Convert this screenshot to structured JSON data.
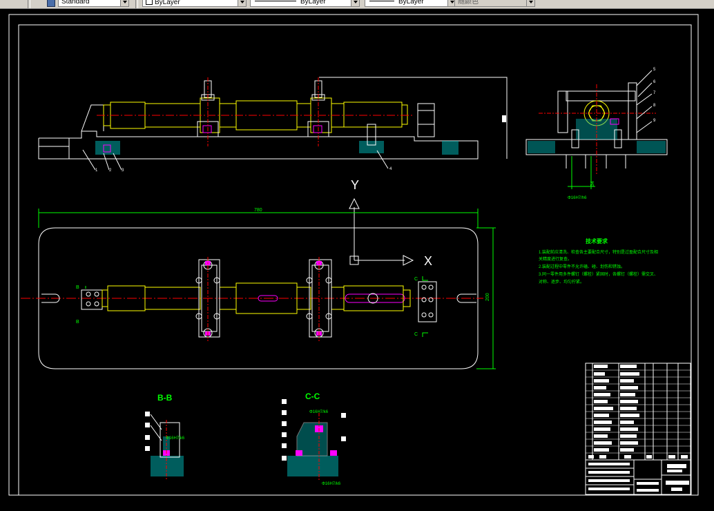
{
  "toolbar": {
    "text_style": "Standard",
    "layer": "ByLayer",
    "linetype": "ByLayer",
    "lineweight": "ByLayer",
    "plot_style": "随颜色"
  },
  "drawing": {
    "section_bb": "B-B",
    "section_cc": "C-C",
    "dim_length": "780",
    "dim_width": "200",
    "dim_fit_top": "Φ16H7/h6",
    "dim_fit_bb": "Φ16H7/k6",
    "dim_fit_cc": "Φ16H7/k6",
    "dim_fit_cc2": "Φ16H7/k6",
    "dim_small": "34",
    "ucs_y": "Y",
    "ucs_x": "X",
    "mark_b": "B",
    "mark_c": "C",
    "part_numbers": [
      "1",
      "2",
      "3",
      "4",
      "5",
      "6",
      "7",
      "8",
      "9"
    ]
  },
  "tech_req": {
    "title": "技术要求",
    "lines": [
      "1.装配前应清洗、检查各主要配合尺寸，特别是过盈配合尺寸及相",
      "关精度进行复查。",
      "2.装配过程中零件不允许磕、碰、划伤和锈蚀。",
      "3.同一零件用多件螺钉（螺栓）紧固时，各螺钉（螺栓）需交叉、",
      "对称、逐步、均匀拧紧。"
    ]
  }
}
